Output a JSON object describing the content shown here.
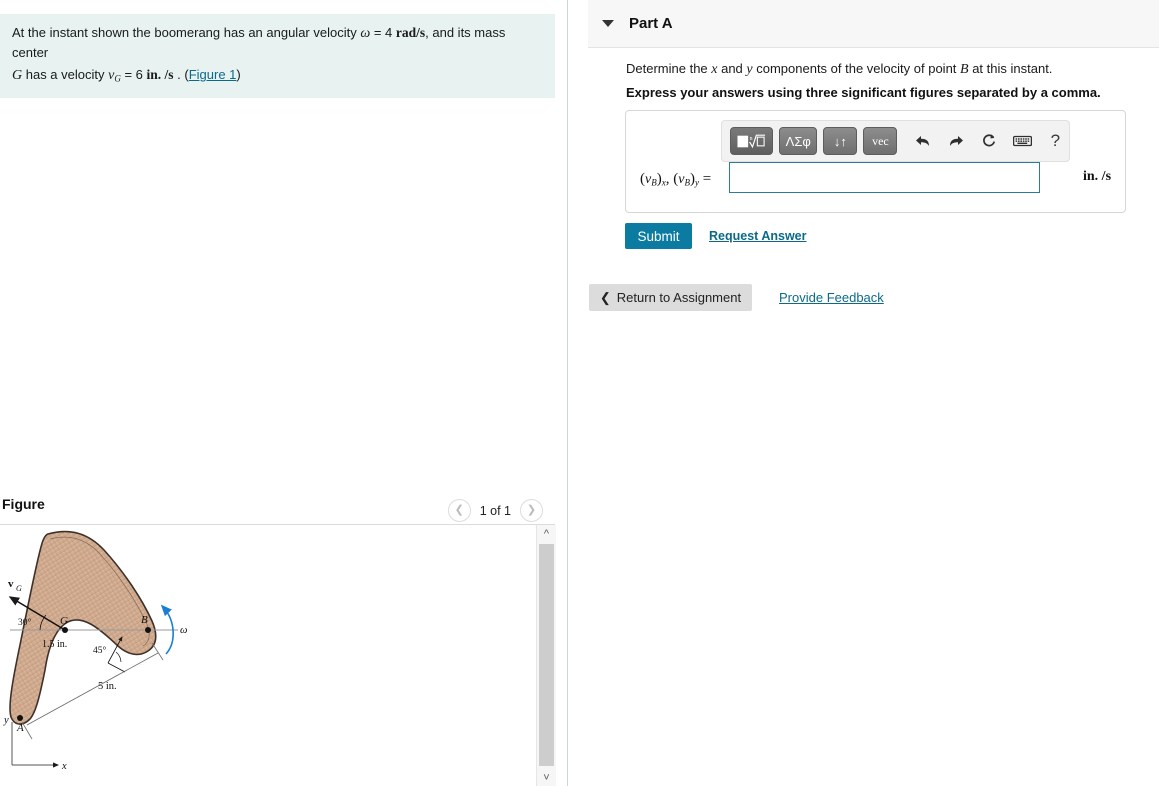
{
  "problem": {
    "text_1a": "At the instant shown the boomerang has an angular velocity ",
    "omega_sym": "ω",
    "eq1": " = 4 ",
    "rad_s": "rad/s",
    "text_1b": ", and its mass center",
    "g_sym": "G",
    "text_2a": " has a velocity ",
    "v_sym": "v",
    "v_sub": "G",
    "eq2": " = 6 ",
    "in_s": "in. /s",
    "text_2b": " . (",
    "figure_link": "Figure 1",
    "text_2c": ")"
  },
  "figure": {
    "title": "Figure",
    "pager_label": "1 of 1",
    "prev_icon": "chevron-left-icon",
    "next_icon": "chevron-right-icon",
    "labels": {
      "vG": "v",
      "vG_sub": "G",
      "angle_30": "30°",
      "angle_45": "45°",
      "point_G": "G",
      "point_B": "B",
      "point_A": "A",
      "omega": "ω",
      "dim_1_5": "1.5 in.",
      "dim_5": "5 in.",
      "axis_x": "x",
      "axis_y": "y"
    },
    "colors": {
      "body_fill": "#d5b49c",
      "body_stroke": "#4a3b33",
      "omega_arc": "#1a7fd4"
    }
  },
  "part": {
    "title": "Part A",
    "caret_icon": "caret-down-icon",
    "question_pre": "Determine the ",
    "question_x": "x",
    "question_mid": " and ",
    "question_y": "y",
    "question_post": " components of the velocity of point ",
    "question_b": "B",
    "question_end": " at this instant.",
    "instruction": "Express your answers using three significant figures separated by a comma."
  },
  "toolbar": {
    "template_sqrt": "■√□",
    "template_greek": "ΛΣφ",
    "template_arrows": "↓↑",
    "template_vec": "vec",
    "undo_icon": "undo-arrow-icon",
    "redo_icon": "redo-arrow-icon",
    "reset_icon": "reset-circular-arrow-icon",
    "keyboard_icon": "keyboard-icon",
    "help_icon": "help-question-icon",
    "undo_glyph": "↩",
    "redo_glyph": "↪",
    "reset_glyph": "↻",
    "keyboard_glyph": "⌨",
    "help_glyph": "?"
  },
  "answer": {
    "label_v": "v",
    "label_b": "B",
    "label_x": "x",
    "label_y": "y",
    "value": "",
    "placeholder": "",
    "units": "in. /s"
  },
  "actions": {
    "submit_label": "Submit",
    "request_answer_label": "Request Answer",
    "return_label": "Return to Assignment",
    "return_icon": "chevron-left-icon",
    "feedback_label": "Provide Feedback"
  },
  "colors": {
    "banner_bg": "#e7f2f1",
    "accent_teal": "#0c7ba2",
    "link": "#0b6a8a",
    "header_bg": "#f7f7f7"
  }
}
